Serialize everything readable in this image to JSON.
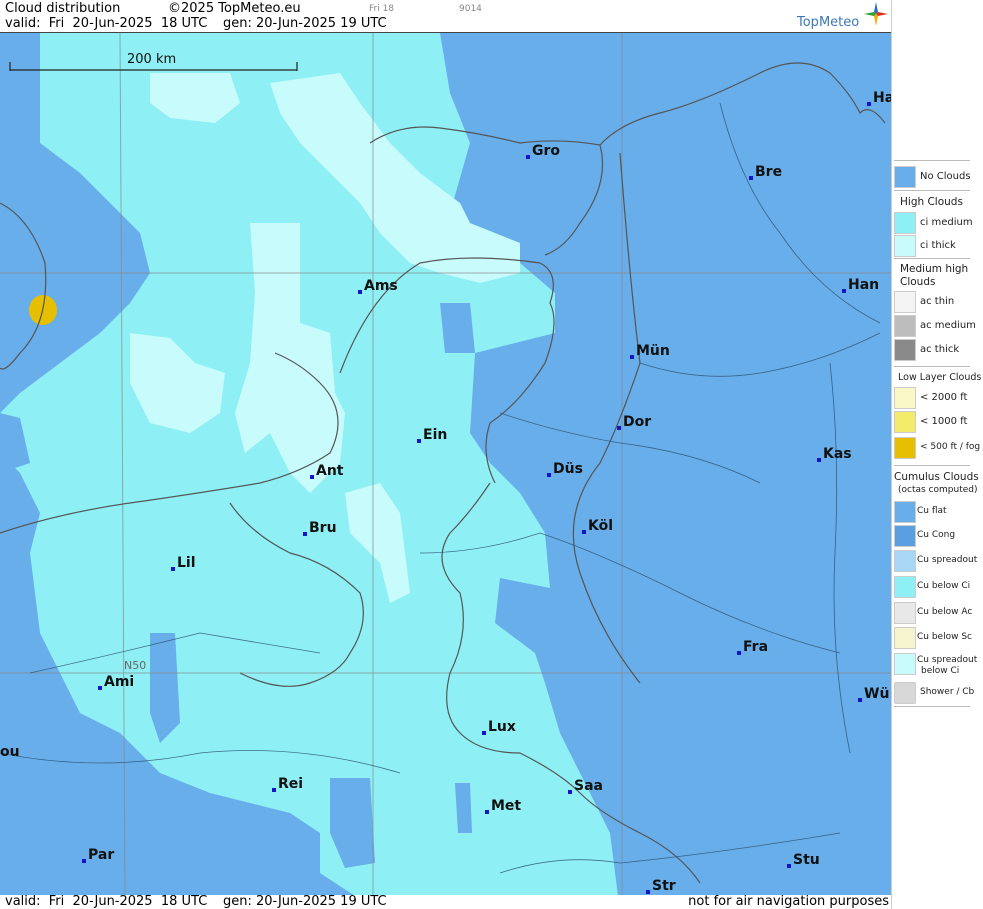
{
  "header": {
    "title": "Cloud distribution",
    "copyright": "©2025 TopMeteo.eu",
    "valid": "valid:  Fri  20-Jun-2025  18 UTC",
    "generated": "gen: 20-Jun-2025 19 UTC",
    "small1": "Fri 18",
    "small2": "9014",
    "brand": "TopMeteo"
  },
  "map": {
    "scale_label": "200 km",
    "lat_label": "N50",
    "cities": [
      {
        "name": "Gro"
      },
      {
        "name": "Bre"
      },
      {
        "name": "Ha"
      },
      {
        "name": "Ams"
      },
      {
        "name": "Han"
      },
      {
        "name": "Mün"
      },
      {
        "name": "Dor"
      },
      {
        "name": "Ein"
      },
      {
        "name": "Ant"
      },
      {
        "name": "Düs"
      },
      {
        "name": "Kas"
      },
      {
        "name": "Bru"
      },
      {
        "name": "Köl"
      },
      {
        "name": "Lil"
      },
      {
        "name": "Ami"
      },
      {
        "name": "Fra"
      },
      {
        "name": "Wü"
      },
      {
        "name": "Lux"
      },
      {
        "name": "ou"
      },
      {
        "name": "Rei"
      },
      {
        "name": "Saa"
      },
      {
        "name": "Met"
      },
      {
        "name": "Par"
      },
      {
        "name": "Stu"
      },
      {
        "name": "Str"
      }
    ]
  },
  "footer": {
    "valid": "valid:  Fri  20-Jun-2025  18 UTC",
    "generated": "gen: 20-Jun-2025 19 UTC",
    "notice": "not for air navigation purposes"
  },
  "legend": {
    "no_clouds": "No Clouds",
    "high_head": "High Clouds",
    "ci_medium": "ci medium",
    "ci_thick": "ci thick",
    "medium_head1": "Medium high",
    "medium_head2": "Clouds",
    "ac_thin": "ac thin",
    "ac_medium": "ac medium",
    "ac_thick": "ac thick",
    "low_head": "Low Layer Clouds",
    "lt2000": "< 2000 ft",
    "lt1000": "< 1000 ft",
    "lt500": "< 500 ft / fog",
    "cu_head1": "Cumulus Clouds",
    "cu_head2": "(octas computed)",
    "cu_flat": "Cu flat",
    "cu_cong": "Cu Cong",
    "cu_spread": "Cu spreadout",
    "cu_below_ci": "Cu below Ci",
    "cu_below_ac": "Cu below Ac",
    "cu_below_sc": "Cu below Sc",
    "cu_spread_ci1": "Cu spreadout",
    "cu_spread_ci2": "below Ci",
    "shower": "Shower / Cb"
  },
  "colors": {
    "no_clouds": "#67aeea",
    "ci_medium": "#8ef0f5",
    "ci_thick": "#c8fbfc",
    "low_fog": "#e6c000",
    "city_dot": "#1414c8"
  }
}
